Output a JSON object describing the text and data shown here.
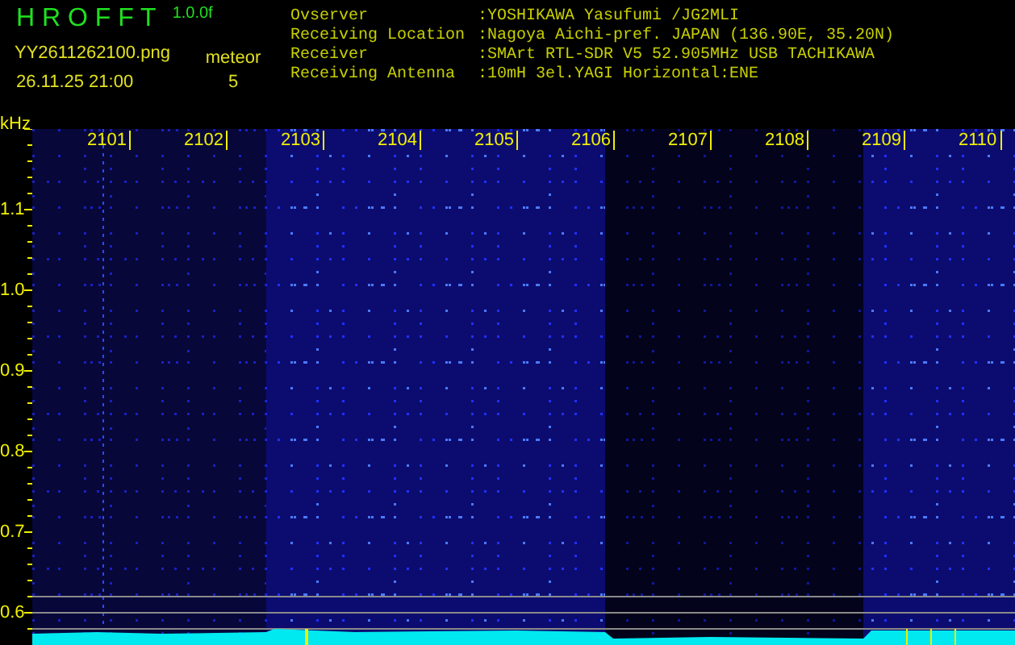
{
  "app": {
    "title": "H R O F F T",
    "version": "1.0.0f"
  },
  "file": {
    "name": "YY2611262100.png",
    "datetime": "26.11.25 21:00"
  },
  "counter": {
    "label": "meteor",
    "value": "5"
  },
  "info": [
    {
      "label": "Ovserver",
      "value": ":YOSHIKAWA Yasufumi /JG2MLI"
    },
    {
      "label": "Receiving Location",
      "value": ":Nagoya Aichi-pref. JAPAN (136.90E, 35.20N)"
    },
    {
      "label": "Receiver",
      "value": ":SMArt RTL-SDR V5 52.905MHz USB TACHIKAWA"
    },
    {
      "label": "Receiving Antenna",
      "value": ":10mH 3el.YAGI Horizontal:ENE"
    }
  ],
  "plot": {
    "y_unit": "kHz",
    "x_labels": [
      "2101",
      "2102",
      "2103",
      "2104",
      "2105",
      "2106",
      "2107",
      "2108",
      "2109",
      "2110"
    ],
    "y_labels": [
      "1.1",
      "1.0",
      "0.9",
      "0.8",
      "0.7",
      "0.6"
    ]
  }
}
